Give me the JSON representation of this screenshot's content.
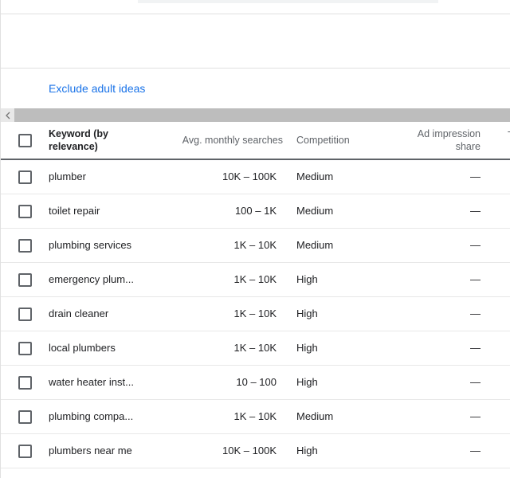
{
  "filters": {
    "exclude_adult_label": "Exclude adult ideas"
  },
  "table": {
    "headers": {
      "keyword": "Keyword (by relevance)",
      "avg_monthly_searches": "Avg. monthly searches",
      "competition": "Competition",
      "ad_impression_share": "Ad impression share",
      "next_col_partial": "T"
    },
    "rows": [
      {
        "keyword": "plumber",
        "avg": "10K – 100K",
        "competition": "Medium",
        "ad_share": "—"
      },
      {
        "keyword": "toilet repair",
        "avg": "100 – 1K",
        "competition": "Medium",
        "ad_share": "—"
      },
      {
        "keyword": "plumbing services",
        "avg": "1K – 10K",
        "competition": "Medium",
        "ad_share": "—"
      },
      {
        "keyword": "emergency plum...",
        "avg": "1K – 10K",
        "competition": "High",
        "ad_share": "—"
      },
      {
        "keyword": "drain cleaner",
        "avg": "1K – 10K",
        "competition": "High",
        "ad_share": "—"
      },
      {
        "keyword": "local plumbers",
        "avg": "1K – 10K",
        "competition": "High",
        "ad_share": "—"
      },
      {
        "keyword": "water heater inst...",
        "avg": "10 – 100",
        "competition": "High",
        "ad_share": "—"
      },
      {
        "keyword": "plumbing compa...",
        "avg": "1K – 10K",
        "competition": "Medium",
        "ad_share": "—"
      },
      {
        "keyword": "plumbers near me",
        "avg": "10K – 100K",
        "competition": "High",
        "ad_share": "—"
      }
    ]
  },
  "colors": {
    "link": "#1a73e8",
    "scrollbar": "#bdbdbd",
    "header_rule": "#5f6368"
  },
  "icons": {
    "scroll_left": "chevron-left-icon"
  }
}
